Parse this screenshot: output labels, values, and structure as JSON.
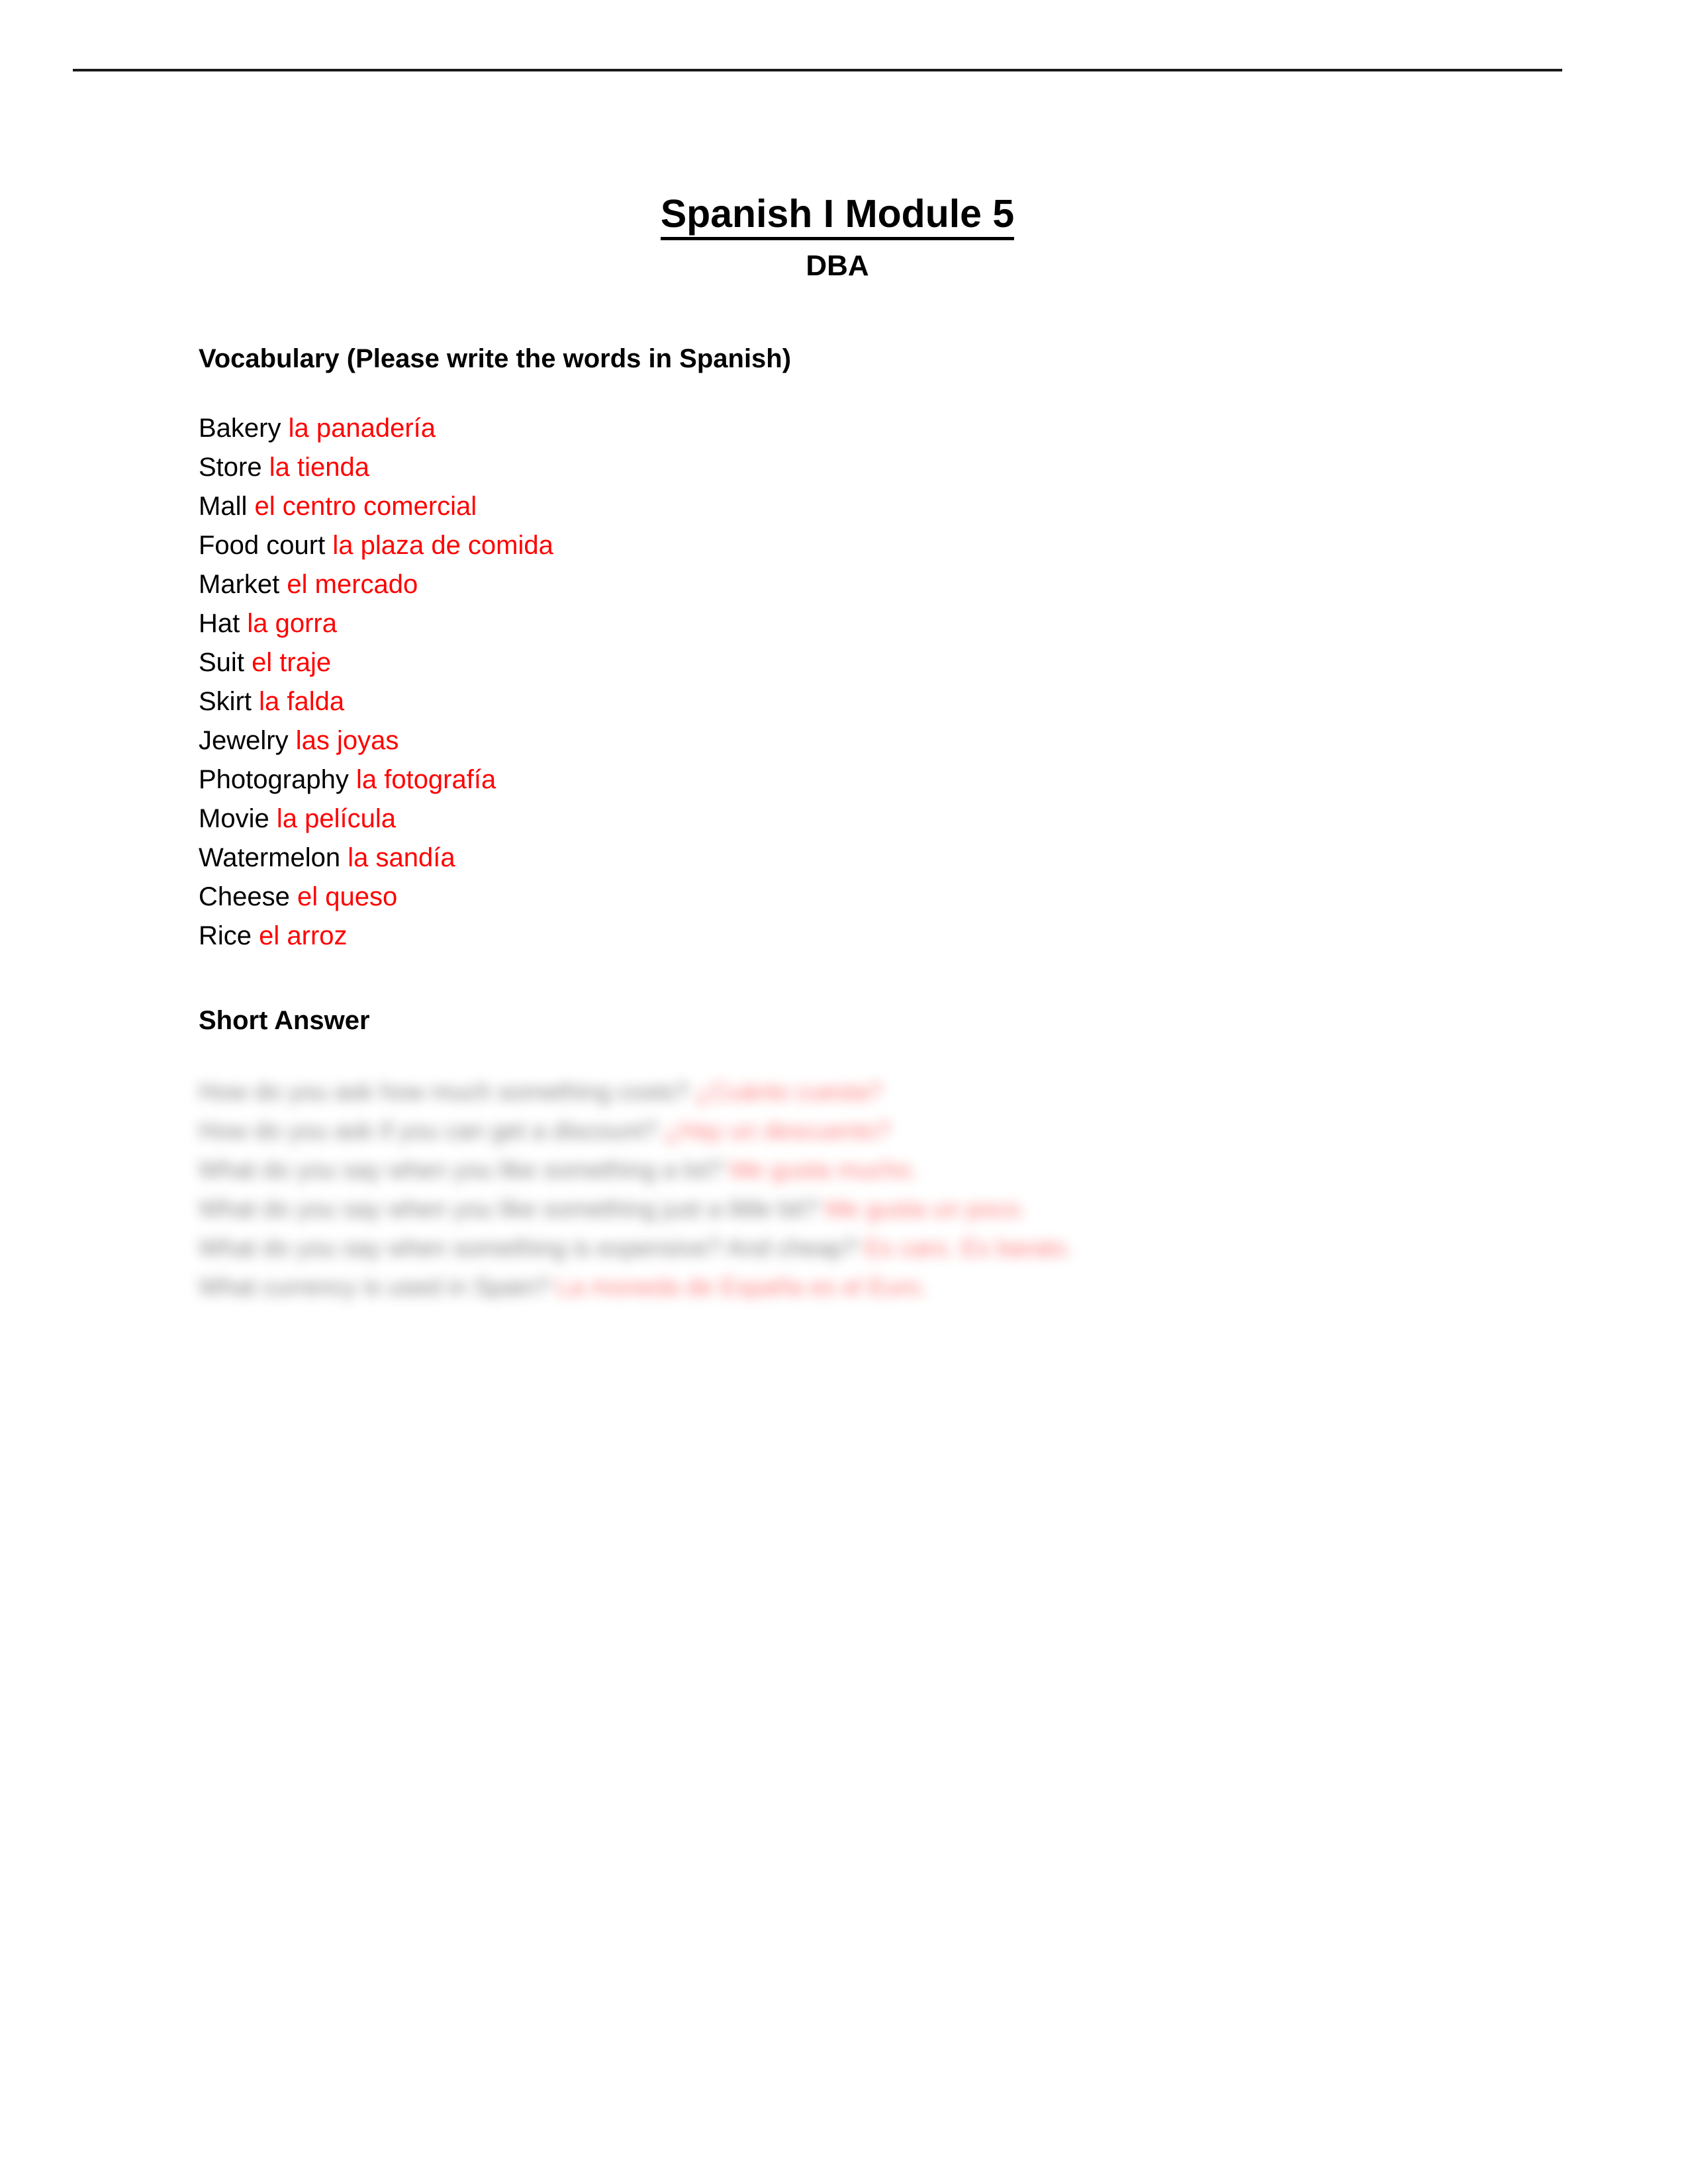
{
  "document": {
    "title": "Spanish I Module 5",
    "subtitle": "DBA"
  },
  "vocabulary": {
    "heading": "Vocabulary (Please write the words in Spanish)",
    "answer_color": "#FF0000",
    "items": [
      {
        "english": "Bakery",
        "spanish": "la panadería"
      },
      {
        "english": "Store",
        "spanish": "la tienda"
      },
      {
        "english": "Mall",
        "spanish": "el centro comercial"
      },
      {
        "english": "Food court",
        "spanish": "la plaza de comida"
      },
      {
        "english": "Market",
        "spanish": "el mercado"
      },
      {
        "english": "Hat",
        "spanish": "la gorra"
      },
      {
        "english": "Suit",
        "spanish": "el traje"
      },
      {
        "english": "Skirt",
        "spanish": "la falda"
      },
      {
        "english": "Jewelry",
        "spanish": "las joyas"
      },
      {
        "english": "Photography",
        "spanish": "la fotografía"
      },
      {
        "english": "Movie",
        "spanish": "la película"
      },
      {
        "english": "Watermelon",
        "spanish": "la sandía"
      },
      {
        "english": "Cheese",
        "spanish": "el queso"
      },
      {
        "english": "Rice",
        "spanish": "el arroz"
      }
    ]
  },
  "short_answer": {
    "heading": "Short Answer",
    "redacted": true,
    "lines": [
      {
        "question": "How do you ask how much something costs?",
        "answer": "¿Cuánto cuesta?"
      },
      {
        "question": "How do you ask if you can get a discount?",
        "answer": "¿Hay un descuento?"
      },
      {
        "question": "What do you say when you like something a lot?",
        "answer": "Me gusta mucho."
      },
      {
        "question": "What do you say when you like something just a little bit?",
        "answer": "Me gusta un poco."
      },
      {
        "question": "What do you say when something is expensive? And cheap?",
        "answer": "Es caro. Es barato."
      },
      {
        "question": "What currency is used in Spain?",
        "answer": "La moneda de España es el Euro."
      }
    ]
  }
}
